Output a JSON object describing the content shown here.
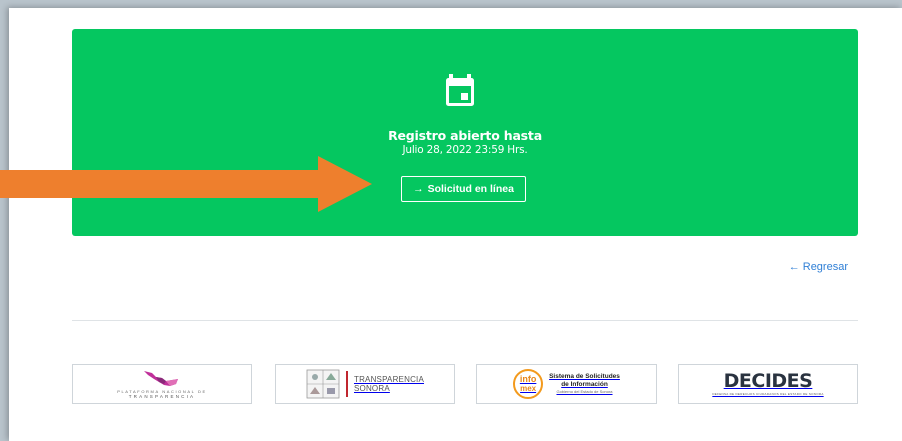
{
  "banner": {
    "title": "Registro abierto hasta",
    "date": "Julio 28, 2022 23:59 Hrs.",
    "button_label": "Solicitud en línea",
    "button_arrow": "→",
    "color": "#05c760"
  },
  "nav": {
    "back_arrow": "←",
    "back_label": "Regresar"
  },
  "logos": {
    "pnt": {
      "line1": "PLATAFORMA NACIONAL DE",
      "line2": "TRANSPARENCIA"
    },
    "transparencia_sonora": {
      "line1": "TRANSPARENCIA",
      "line2": "SONORA"
    },
    "infomex": {
      "badge_top": "info",
      "badge_bottom": "mex",
      "line1": "Sistema de Solicitudes",
      "line2": "de Información",
      "line3": "Gobierno del Estado de Sonora"
    },
    "decides": {
      "title": "DECIDES",
      "subtitle": "DEFENSA DE DERECHOS CIUDADANOS DEL ESTADO DE SONORA"
    }
  },
  "colors": {
    "accent_arrow": "#ee7f2d",
    "link": "#2f7fd6"
  }
}
